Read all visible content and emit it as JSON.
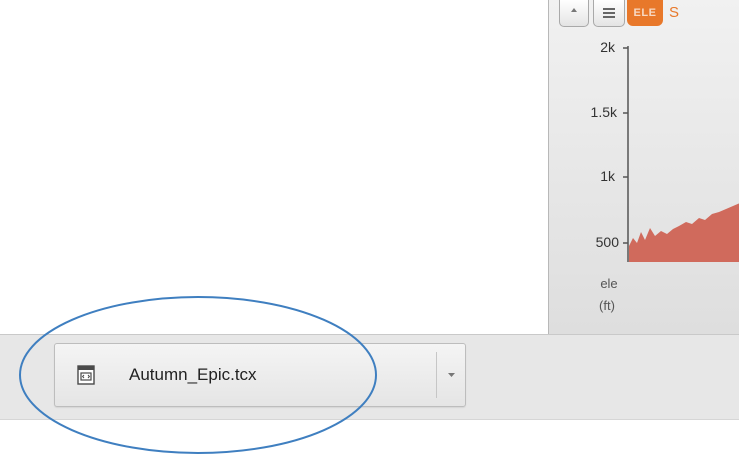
{
  "elevation_panel": {
    "buttons": {
      "pin_icon": "pin-icon",
      "menu_icon": "menu-icon",
      "ele_label": "ELE",
      "truncated_text": "S"
    },
    "y_axis": {
      "ticks": [
        "2k",
        "1.5k",
        "1k",
        "500"
      ],
      "title_line1": "ele",
      "title_line2": "(ft)"
    },
    "colors": {
      "fill": "#d06a5c",
      "accent": "#e8782a"
    }
  },
  "download_bar": {
    "file_name": "Autumn_Epic.tcx",
    "file_icon": "file-icon",
    "dropdown_icon": "chevron-down-icon"
  },
  "annotation": {
    "ellipse_color": "#3f7fc0"
  }
}
